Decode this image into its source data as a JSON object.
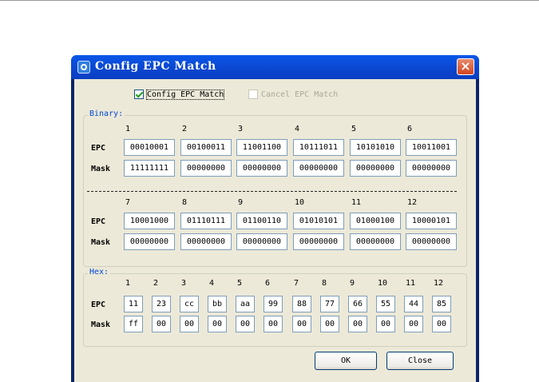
{
  "dialog": {
    "title": "Config EPC Match",
    "close_icon": "×"
  },
  "checks": {
    "config": {
      "label": "Config EPC Match",
      "checked": true
    },
    "cancel": {
      "label": "Cancel EPC Match",
      "checked": false,
      "disabled": true
    }
  },
  "binary": {
    "legend": "Binary:",
    "epc_label": "EPC",
    "mask_label": "Mask",
    "group1": {
      "columns": [
        "1",
        "2",
        "3",
        "4",
        "5",
        "6"
      ],
      "epc": [
        "00010001",
        "00100011",
        "11001100",
        "10111011",
        "10101010",
        "10011001"
      ],
      "mask": [
        "11111111",
        "00000000",
        "00000000",
        "00000000",
        "00000000",
        "00000000"
      ]
    },
    "group2": {
      "columns": [
        "7",
        "8",
        "9",
        "10",
        "11",
        "12"
      ],
      "epc": [
        "10001000",
        "01110111",
        "01100110",
        "01010101",
        "01000100",
        "10000101"
      ],
      "mask": [
        "00000000",
        "00000000",
        "00000000",
        "00000000",
        "00000000",
        "00000000"
      ]
    }
  },
  "hex": {
    "legend": "Hex:",
    "epc_label": "EPC",
    "mask_label": "Mask",
    "columns": [
      "1",
      "2",
      "3",
      "4",
      "5",
      "6",
      "7",
      "8",
      "9",
      "10",
      "11",
      "12"
    ],
    "epc": [
      "11",
      "23",
      "cc",
      "bb",
      "aa",
      "99",
      "88",
      "77",
      "66",
      "55",
      "44",
      "85"
    ],
    "mask": [
      "ff",
      "00",
      "00",
      "00",
      "00",
      "00",
      "00",
      "00",
      "00",
      "00",
      "00",
      "00"
    ]
  },
  "buttons": {
    "ok": "OK",
    "close": "Close"
  },
  "colors": {
    "titlebar": "#0b46cf",
    "client": "#ece9d8",
    "legend": "#0046d5"
  }
}
